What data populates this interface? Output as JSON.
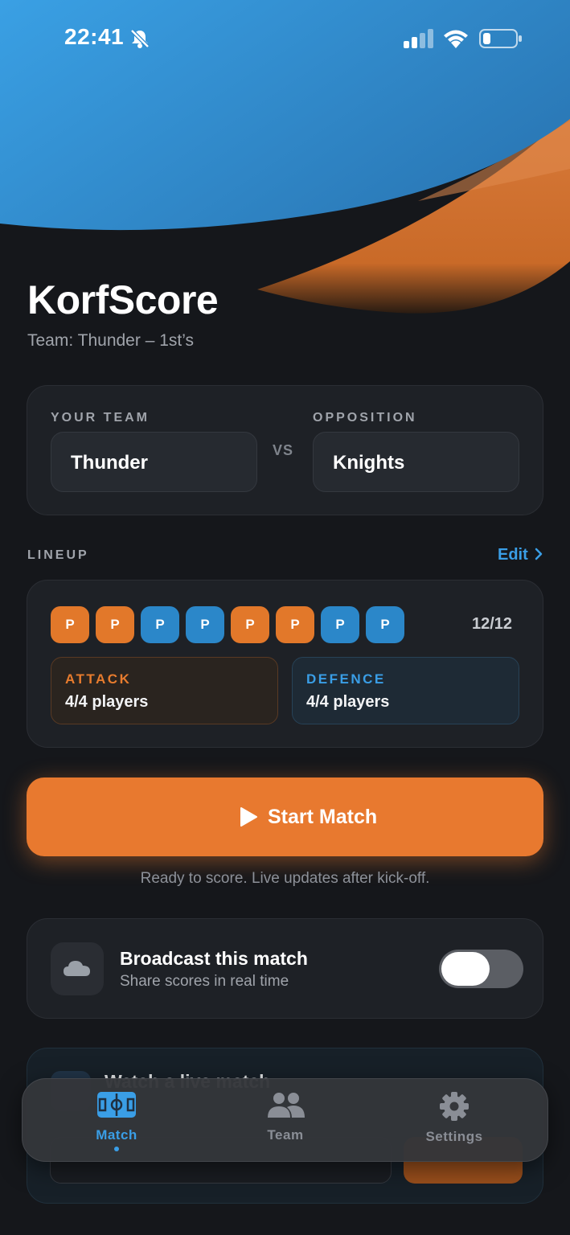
{
  "status": {
    "time": "22:41"
  },
  "app": {
    "title": "KorfScore",
    "subtitle": "Team: Thunder – 1st’s"
  },
  "teams": {
    "your_label": "YOUR TEAM",
    "your_value": "Thunder",
    "vs": "VS",
    "opp_label": "OPPOSITION",
    "opp_value": "Knights"
  },
  "lineup": {
    "label": "LINEUP",
    "edit": "Edit",
    "chips": [
      "P",
      "P",
      "P",
      "P",
      "P",
      "P",
      "P",
      "P"
    ],
    "chip_roles": [
      "attack",
      "attack",
      "defence",
      "defence",
      "attack",
      "attack",
      "defence",
      "defence"
    ],
    "count": "12/12",
    "attack": {
      "title": "ATTACK",
      "sub": "4/4 players"
    },
    "defence": {
      "title": "DEFENCE",
      "sub": "4/4 players"
    }
  },
  "start": {
    "label": "Start Match",
    "hint": "Ready to score. Live updates after kick-off."
  },
  "broadcast": {
    "title": "Broadcast this match",
    "sub": "Share scores in real time",
    "enabled": false,
    "icon": "cloud-icon"
  },
  "live": {
    "title": "Watch a live match"
  },
  "tabs": [
    {
      "label": "Match",
      "icon": "pitch-icon",
      "active": true
    },
    {
      "label": "Team",
      "icon": "people-icon",
      "active": false
    },
    {
      "label": "Settings",
      "icon": "gear-icon",
      "active": false
    }
  ],
  "colors": {
    "accent_orange": "#e8792f",
    "accent_blue": "#3a9ee6",
    "background": "#15171b"
  }
}
